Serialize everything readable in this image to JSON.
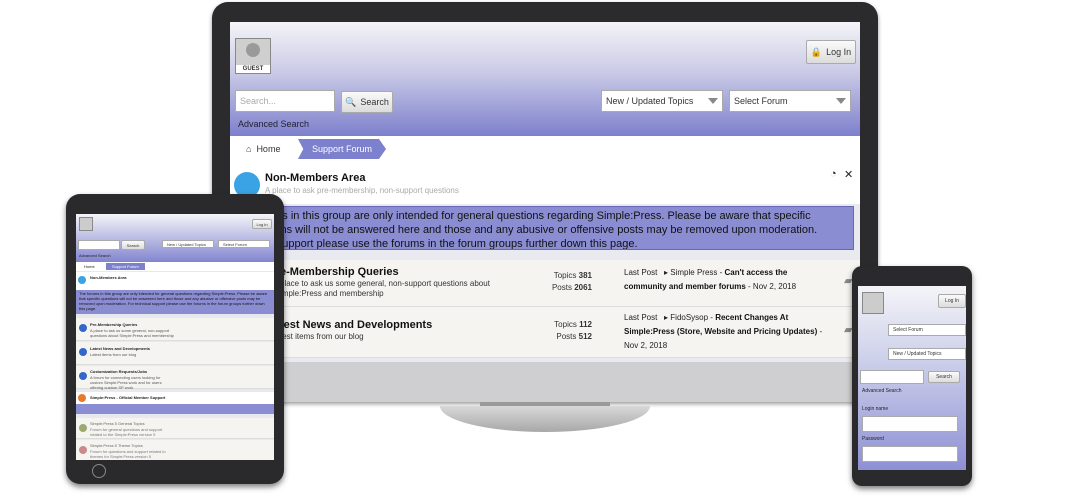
{
  "monitor": {
    "avatar_label": "GUEST",
    "login_label": "Log In",
    "search_placeholder": "Search...",
    "search_button": "Search",
    "topics_select": "New / Updated Topics",
    "forum_select": "Select Forum",
    "advanced_search": "Advanced Search",
    "breadcrumb": {
      "home": "Home",
      "current": "Support Forum"
    },
    "group": {
      "title": "Non-Members Area",
      "description": "A place to ask pre-membership, non-support questions"
    },
    "notice_lines": [
      "e forums in this group are only intended for general questions regarding Simple:Press. Please be aware that specific",
      "questions will not be answered here and those and any abusive or offensive posts may be removed upon moderation.",
      "hnical support please use the forums in the forum groups further down this page."
    ],
    "forums": [
      {
        "title": "e-Membership Queries",
        "desc_lines": [
          "place to ask us some general, non-support questions about",
          "imple:Press and membership"
        ],
        "topics_label": "Topics",
        "topics": "381",
        "posts_label": "Posts",
        "posts": "2061",
        "last_post_label": "Last Post",
        "last_user": "Simple Press",
        "last_title_line1": "Can't access the",
        "last_title_line2": "community and member forums",
        "last_date": "Nov 2, 2018"
      },
      {
        "title": "test News and Developments",
        "desc_lines": [
          "test items from our blog"
        ],
        "topics_label": "Topics",
        "topics": "112",
        "posts_label": "Posts",
        "posts": "512",
        "last_post_label": "Last Post",
        "last_user": "FidoSysop",
        "last_title_line1": "Recent Changes At",
        "last_title_line2": "Simple:Press (Store, Website and Pricing Updates)",
        "last_date": "Nov 2, 2018"
      }
    ]
  },
  "tablet": {
    "login_label": "Log In",
    "search_button": "Search",
    "topics_select": "New / Updated Topics",
    "forum_select": "Select Forum",
    "advanced_search": "Advanced Search",
    "breadcrumb": {
      "home": "Home",
      "current": "Support Forum"
    },
    "group_title": "Non-Members Area",
    "notice": "The forums in this group are only intended for general questions regarding Simple:Press. Please be aware that specific questions will not be answered here and those and any abusive or offensive posts may be removed upon moderation. For technical support please use the forums in the forum groups further down this page.",
    "forums": [
      {
        "title": "Pre-Membership Queries",
        "desc": "A place to ask us some general, non-support questions about Simple:Press and membership"
      },
      {
        "title": "Latest News and Developments",
        "desc": "Latest items from our blog"
      },
      {
        "title": "Customization Requests/Jobs",
        "desc": "A forum for connecting users looking for custom Simple:Press work and for users offering custom SP work"
      }
    ],
    "group2_title": "Simple:Press - Official Member Support",
    "forums2": [
      {
        "title": "Simple:Press 5 General Topics",
        "desc": "Forum for general questions and support related to the Simple:Press version 5"
      },
      {
        "title": "Simple:Press 5 Theme Topics",
        "desc": "Forum for questions and support related to themes for Simple:Press version 5"
      }
    ]
  },
  "phone": {
    "login_label": "Log In",
    "forum_select": "Select Forum",
    "topics_select": "New / Updated Topics",
    "search_button": "Search",
    "advanced_search": "Advanced Search",
    "login_name_label": "Login name",
    "password_label": "Password"
  },
  "colors": {
    "accent": "#7d80cc",
    "notice_bg": "#8a8dd2",
    "device_frame": "#2a2a2c"
  }
}
